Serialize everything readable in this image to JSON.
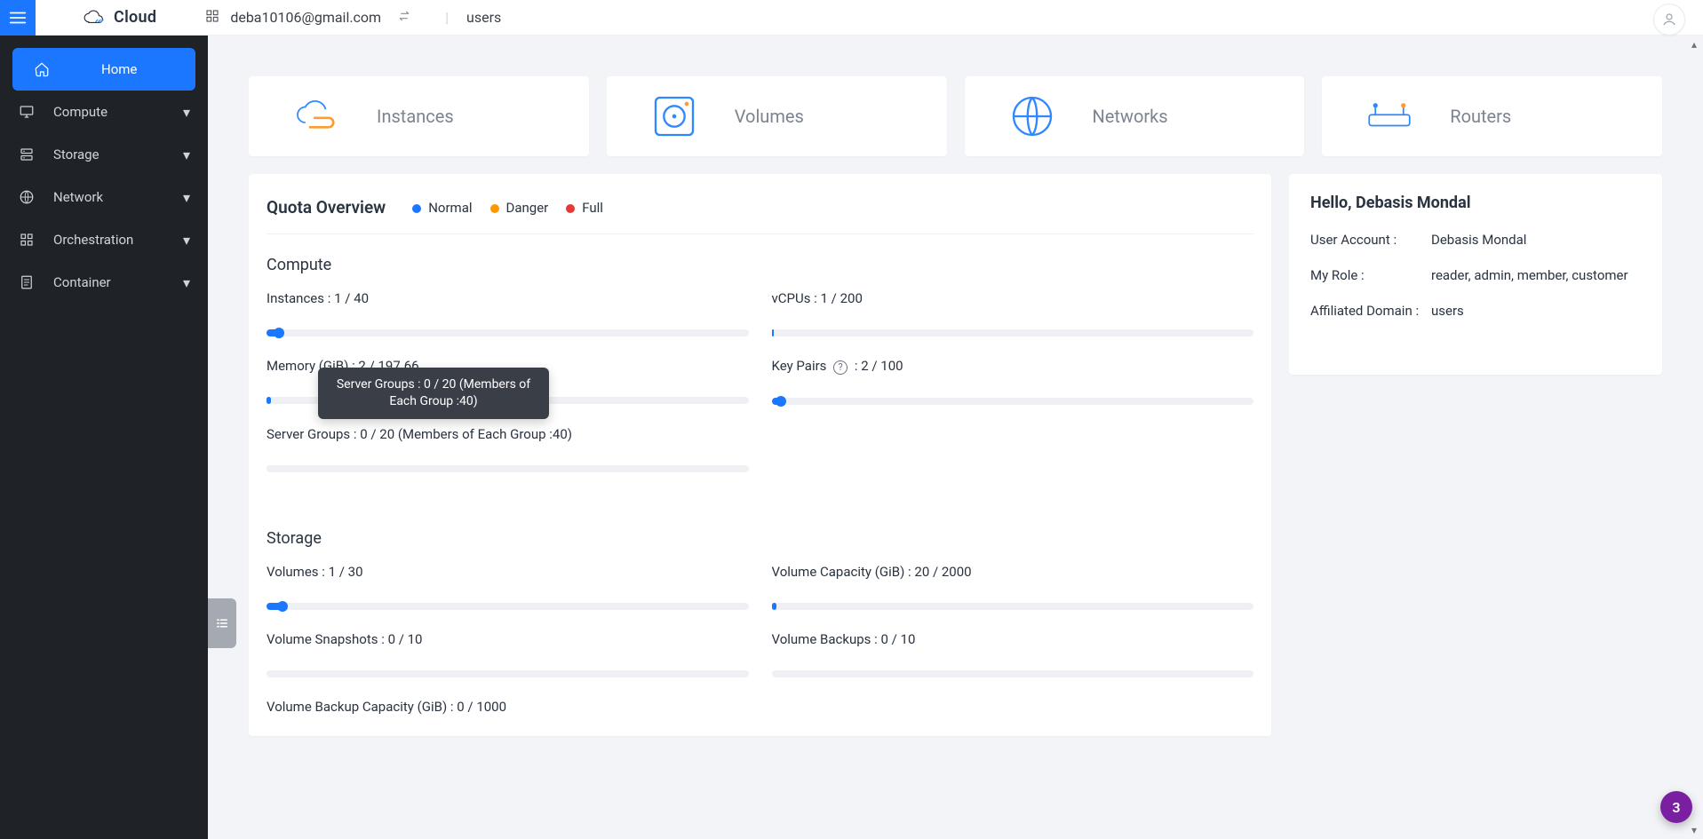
{
  "header": {
    "brand": "Cloud",
    "email": "deba10106@gmail.com",
    "domain": "users"
  },
  "fab": {
    "count": "3"
  },
  "sidebar": {
    "items": [
      {
        "label": "Home",
        "icon": "home",
        "active": true,
        "expandable": false
      },
      {
        "label": "Compute",
        "icon": "monitor",
        "active": false,
        "expandable": true
      },
      {
        "label": "Storage",
        "icon": "server",
        "active": false,
        "expandable": true
      },
      {
        "label": "Network",
        "icon": "globe",
        "active": false,
        "expandable": true
      },
      {
        "label": "Orchestration",
        "icon": "grid",
        "active": false,
        "expandable": true
      },
      {
        "label": "Container",
        "icon": "doc",
        "active": false,
        "expandable": true
      }
    ]
  },
  "cards": [
    {
      "title": "Instances",
      "icon": "cloud"
    },
    {
      "title": "Volumes",
      "icon": "disk"
    },
    {
      "title": "Networks",
      "icon": "globe"
    },
    {
      "title": "Routers",
      "icon": "router"
    }
  ],
  "quota": {
    "title": "Quota Overview",
    "legend": {
      "normal": "Normal",
      "danger": "Danger",
      "full": "Full"
    },
    "sections": [
      {
        "name": "Compute",
        "items": [
          {
            "label": "Instances : 1 / 40",
            "pct": 2.5
          },
          {
            "label": "vCPUs : 1 / 200",
            "pct": 0.5
          },
          {
            "label": "Memory (GiB) : 2 / 197.66",
            "pct": 1.0
          },
          {
            "label": "Key Pairs",
            "suffix": " : 2 / 100",
            "help": true,
            "pct": 2.0
          },
          {
            "label": "Server Groups : 0 / 20 (Members of Each Group :40)",
            "pct": 0
          }
        ],
        "tooltip": "Server Groups : 0 / 20 (Members of Each Group :40)"
      },
      {
        "name": "Storage",
        "items": [
          {
            "label": "Volumes : 1 / 30",
            "pct": 3.3
          },
          {
            "label": "Volume Capacity (GiB) : 20 / 2000",
            "pct": 1.0
          },
          {
            "label": "Volume Snapshots : 0 / 10",
            "pct": 0
          },
          {
            "label": "Volume Backups : 0 / 10",
            "pct": 0
          },
          {
            "label": "Volume Backup Capacity (GiB) : 0 / 1000",
            "pct": 0
          }
        ]
      }
    ]
  },
  "profile": {
    "greeting": "Hello, Debasis Mondal",
    "account_label": "User Account :",
    "account": "Debasis Mondal",
    "role_label": "My Role :",
    "role": "reader, admin, member, customer",
    "domain_label": "Affiliated Domain :",
    "domain": "users"
  }
}
